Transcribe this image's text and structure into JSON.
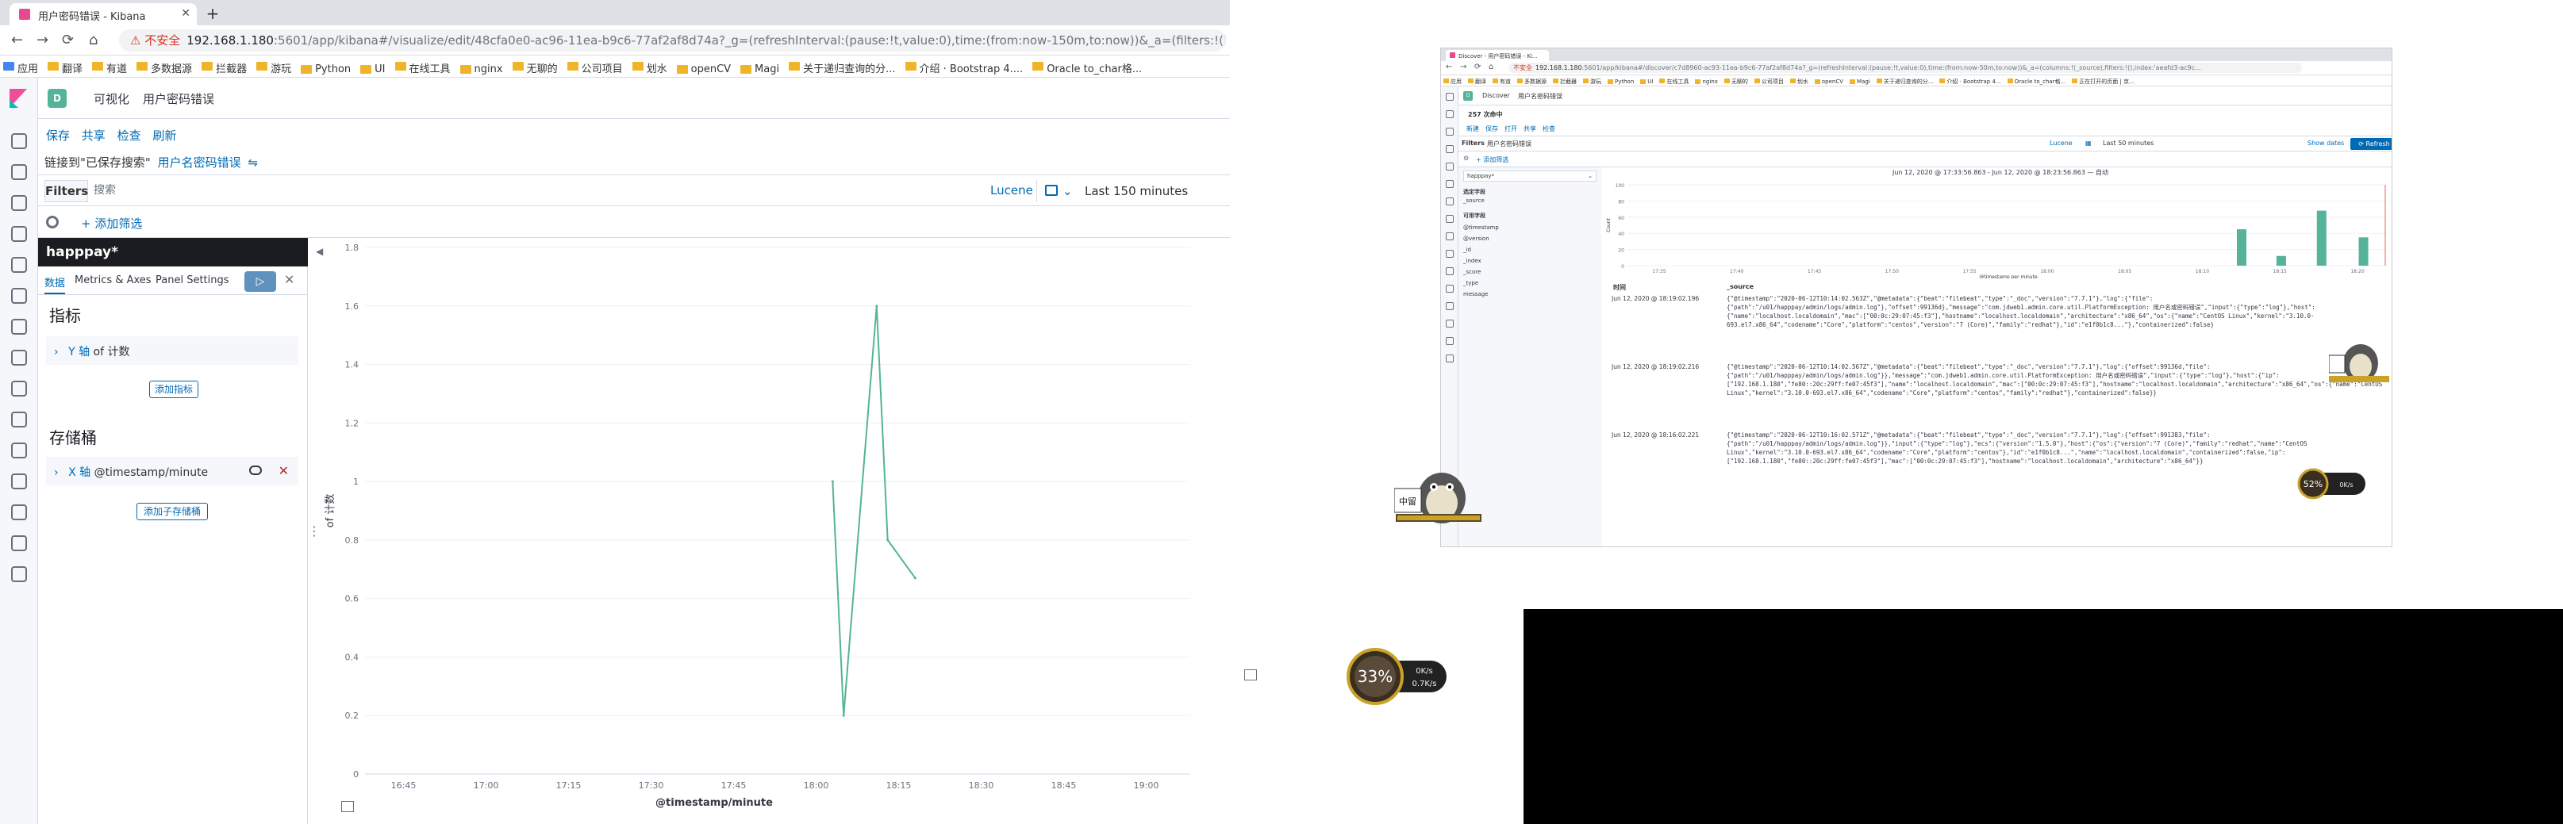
{
  "left_browser": {
    "tab_title": "用户密码错误 - Kibana",
    "url_security": "不安全",
    "url_host": "192.168.1.180",
    "url_path": ":5601/app/kibana#/visualize/edit/48cfa0e0-ac96-11ea-b9c6-77af2af8d74a?_g=(refreshInterval:(pause:!t,value:0),time:(from:now-150m,to:now))&_a=(filters:!(),linked:!t,query:(language:",
    "bookmarks": [
      "应用",
      "翻译",
      "有道",
      "多数据源",
      "拦截器",
      "游玩",
      "Python",
      "UI",
      "在线工具",
      "nginx",
      "无聊的",
      "公司项目",
      "划水",
      "openCV",
      "Magi",
      "关于递归查询的分...",
      "介绍 · Bootstrap 4....",
      "Oracle to_char格..."
    ]
  },
  "kibana": {
    "space_letter": "D",
    "breadcrumb_root": "可视化",
    "breadcrumb_current": "用户密码错误",
    "menu": [
      "保存",
      "共享",
      "检查",
      "刷新"
    ],
    "linked_prefix": "链接到\"已保存搜索\"",
    "linked_name": "用户名密码错误",
    "filters_label": "Filters",
    "search_placeholder": "搜索",
    "query_language": "Lucene",
    "time_range": "Last 150 minutes",
    "add_filter": "+ 添加筛选"
  },
  "editor": {
    "title": "happpay*",
    "tabs": [
      "数据",
      "Metrics & Axes",
      "Panel Settings"
    ],
    "metrics_heading": "指标",
    "metric_row_prefix": "Y 轴",
    "metric_row_suffix": "of 计数",
    "add_metric": "添加指标",
    "buckets_heading": "存储桶",
    "bucket_row_prefix": "X 轴",
    "bucket_row_suffix": "@timestamp/minute",
    "add_bucket": "添加子存储桶"
  },
  "chart_data": {
    "type": "line",
    "x": [
      "18:03",
      "18:05",
      "18:11",
      "18:13",
      "18:18"
    ],
    "values": [
      1,
      0.2,
      1.6,
      0.8,
      0.67
    ],
    "x_ticks": [
      "16:45",
      "17:00",
      "17:15",
      "17:30",
      "17:45",
      "18:00",
      "18:15",
      "18:30",
      "18:45",
      "19:00"
    ],
    "y_ticks": [
      "0",
      "0.2",
      "0.4",
      "0.6",
      "0.8",
      "1",
      "1.2",
      "1.4",
      "1.6",
      "1.8"
    ],
    "ylabel": "of 计数",
    "xlabel": "@timestamp/minute",
    "ylim": [
      0,
      1.8
    ],
    "color": "#54b399"
  },
  "right_browser": {
    "tab_title": "Discover - 用户密码错误 - Ki...",
    "url_security": "不安全",
    "url_host": "192.168.1.180",
    "url_path": ":5601/app/kibana#/discover/c7d8960-ac93-11ea-b9c6-77af2af8d74a?_g=(refreshInterval:(pause:!t,value:0),time:(from:now-50m,to:now))&_a=(columns:!(_source),filters:!(),index:'aeafd3-ac9c...",
    "bookmarks": [
      "应用",
      "翻译",
      "有道",
      "多数据源",
      "拦截器",
      "游玩",
      "Python",
      "UI",
      "在线工具",
      "nginx",
      "无聊的",
      "公司项目",
      "划水",
      "openCV",
      "Magi",
      "关于递归查询的分...",
      "介绍 · Bootstrap 4...",
      "Oracle to_char格...",
      "正在打开的页面 | 京..."
    ],
    "app_name": "Discover",
    "crumb": "用户名密码错误",
    "hits": "257 次命中",
    "menu": [
      "新建",
      "保存",
      "打开",
      "共享",
      "检查"
    ],
    "query_text": "用户名密码错误",
    "language": "Lucene",
    "time": "Last 50 minutes",
    "show_dates": "Show dates",
    "refresh": "Refresh",
    "add_filter": "+ 添加筛选",
    "index": "happpay*",
    "selected_fields_label": "选定字段",
    "available_fields_label": "可用字段",
    "fields": [
      "_source",
      "@timestamp",
      "@version",
      "_id",
      "_index",
      "_score",
      "_type",
      "message"
    ],
    "range_text": "Jun 12, 2020 @ 17:33:56.863 - Jun 12, 2020 @ 18:23:56.863 —",
    "interval": "自动",
    "hist_yaxis": "Count",
    "hist_xaxis": "@timestamp per minute",
    "hist_y_ticks": [
      "0",
      "20",
      "40",
      "60",
      "80",
      "100"
    ],
    "hist_x_ticks": [
      "17:35",
      "17:40",
      "17:45",
      "17:50",
      "17:55",
      "18:00",
      "18:05",
      "18:10",
      "18:15",
      "18:20"
    ],
    "hist_values": [
      45,
      12,
      68,
      35
    ],
    "col_time": "时间",
    "col_source": "_source",
    "docs": [
      {
        "time": "Jun 12, 2020 @ 18:19:02.196",
        "text": "{\"@timestamp\":\"2020-06-12T10:14:02.563Z\",\"@metadata\":{\"beat\":\"filebeat\",\"type\":\"_doc\",\"version\":\"7.7.1\"},\"log\":{\"file\":{\"path\":\"/u01/happpay/admin/logs/admin.log\"},\"offset\":99136d},\"message\":\"com.jdweb1.admin.core.util.PlatformException: 用户名或密码错误\",\"input\":{\"type\":\"log\"},\"host\":{\"name\":\"localhost.localdomain\",\"mac\":[\"00:0c:29:07:45:f3\"],\"hostname\":\"localhost.localdomain\",\"architecture\":\"x86_64\",\"os\":{\"name\":\"CentOS Linux\",\"kernel\":\"3.10.0-693.el7.x86_64\",\"codename\":\"Core\",\"platform\":\"centos\",\"version\":\"7 (Core)\",\"family\":\"redhat\"},\"id\":\"e1f0b1c8...\"},\"containerized\":false}"
      },
      {
        "time": "Jun 12, 2020 @ 18:19:02.216",
        "text": "{\"@timestamp\":\"2020-06-12T10:14:02.567Z\",\"@metadata\":{\"beat\":\"filebeat\",\"type\":\"_doc\",\"version\":\"7.7.1\"},\"log\":{\"offset\":99136d,\"file\":{\"path\":\"/u01/happpay/admin/logs/admin.log\"}},\"message\":\"com.jdweb1.admin.core.util.PlatformException: 用户名或密码错误\",\"input\":{\"type\":\"log\"},\"host\":{\"ip\":[\"192.168.1.180\",\"fe80::20c:29ff:fe07:45f3\"],\"name\":\"localhost.localdomain\",\"mac\":[\"00:0c:29:07:45:f3\"],\"hostname\":\"localhost.localdomain\",\"architecture\":\"x86_64\",\"os\":{\"name\":\"CentOS Linux\",\"kernel\":\"3.10.0-693.el7.x86_64\",\"codename\":\"Core\",\"platform\":\"centos\",\"family\":\"redhat\"},\"containerized\":false}}"
      },
      {
        "time": "Jun 12, 2020 @ 18:16:02.221",
        "text": "{\"@timestamp\":\"2020-06-12T10:16:02.571Z\",\"@metadata\":{\"beat\":\"filebeat\",\"type\":\"_doc\",\"version\":\"7.7.1\"},\"log\":{\"offset\":991383,\"file\":{\"path\":\"/u01/happpay/admin/logs/admin.log\"}},\"input\":{\"type\":\"log\"},\"ecs\":{\"version\":\"1.5.0\"},\"host\":{\"os\":{\"version\":\"7 (Core)\",\"family\":\"redhat\",\"name\":\"CentOS Linux\",\"kernel\":\"3.10.0-693.el7.x86_64\",\"codename\":\"Core\",\"platform\":\"centos\"},\"id\":\"e1f0b1c8...\",\"name\":\"localhost.localdomain\",\"containerized\":false,\"ip\":[\"192.168.1.180\",\"fe80::20c:29ff:fe07:45f3\"],\"mac\":[\"00:0c:29:07:45:f3\"],\"hostname\":\"localhost.localdomain\",\"architecture\":\"x86_64\"}}"
      }
    ]
  },
  "widgets": {
    "speed_small": "52%",
    "speed_small_net": "0K/s",
    "speed_big": "33%",
    "speed_big_up": "0K/s",
    "speed_big_down": "0.7K/s",
    "mascot_label": "中留"
  }
}
